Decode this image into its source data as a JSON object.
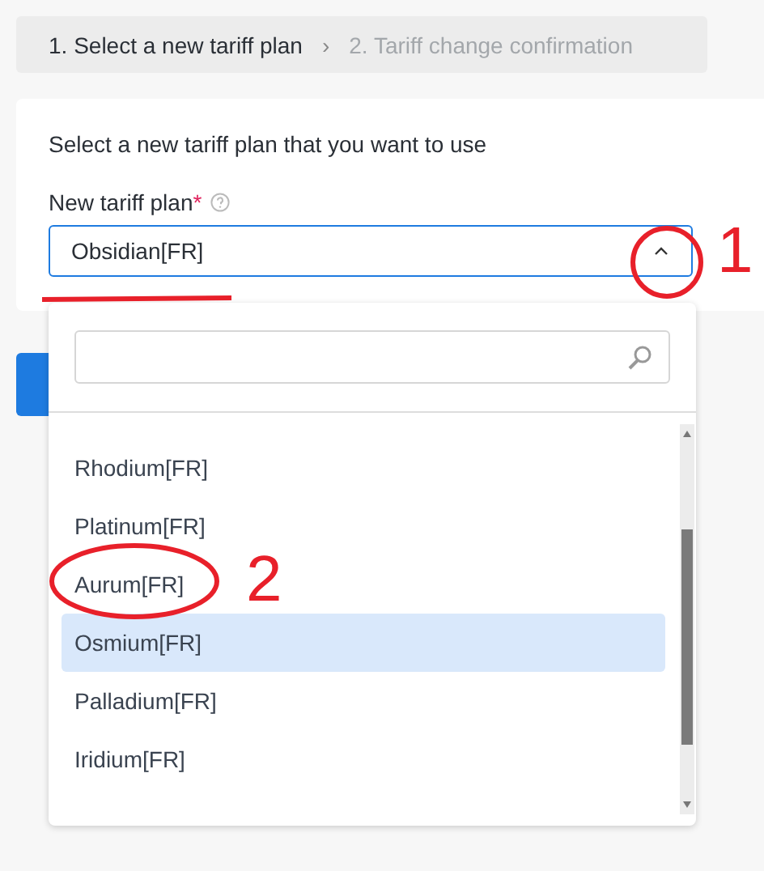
{
  "breadcrumb": [
    {
      "label": "1. Select a new tariff plan",
      "selected": true
    },
    {
      "label": "2. Tariff change confirmation",
      "selected": false
    }
  ],
  "breadcrumb_separator": "›",
  "card": {
    "intro": "Select a new tariff plan that you want to use",
    "field_label": "New tariff plan",
    "required_mark": "*",
    "value": "Obsidian[FR]",
    "expanded": true
  },
  "dropdown": {
    "options": [
      {
        "label": "Rhodium[FR]",
        "selected": false
      },
      {
        "label": "Platinum[FR]",
        "selected": false
      },
      {
        "label": "Aurum[FR]",
        "selected": false
      },
      {
        "label": "Osmium[FR]",
        "selected": true
      },
      {
        "label": "Palladium[FR]",
        "selected": false
      },
      {
        "label": "Iridium[FR]",
        "selected": false
      }
    ]
  },
  "annotations": [
    {
      "label": "1"
    },
    {
      "label": "2"
    }
  ]
}
